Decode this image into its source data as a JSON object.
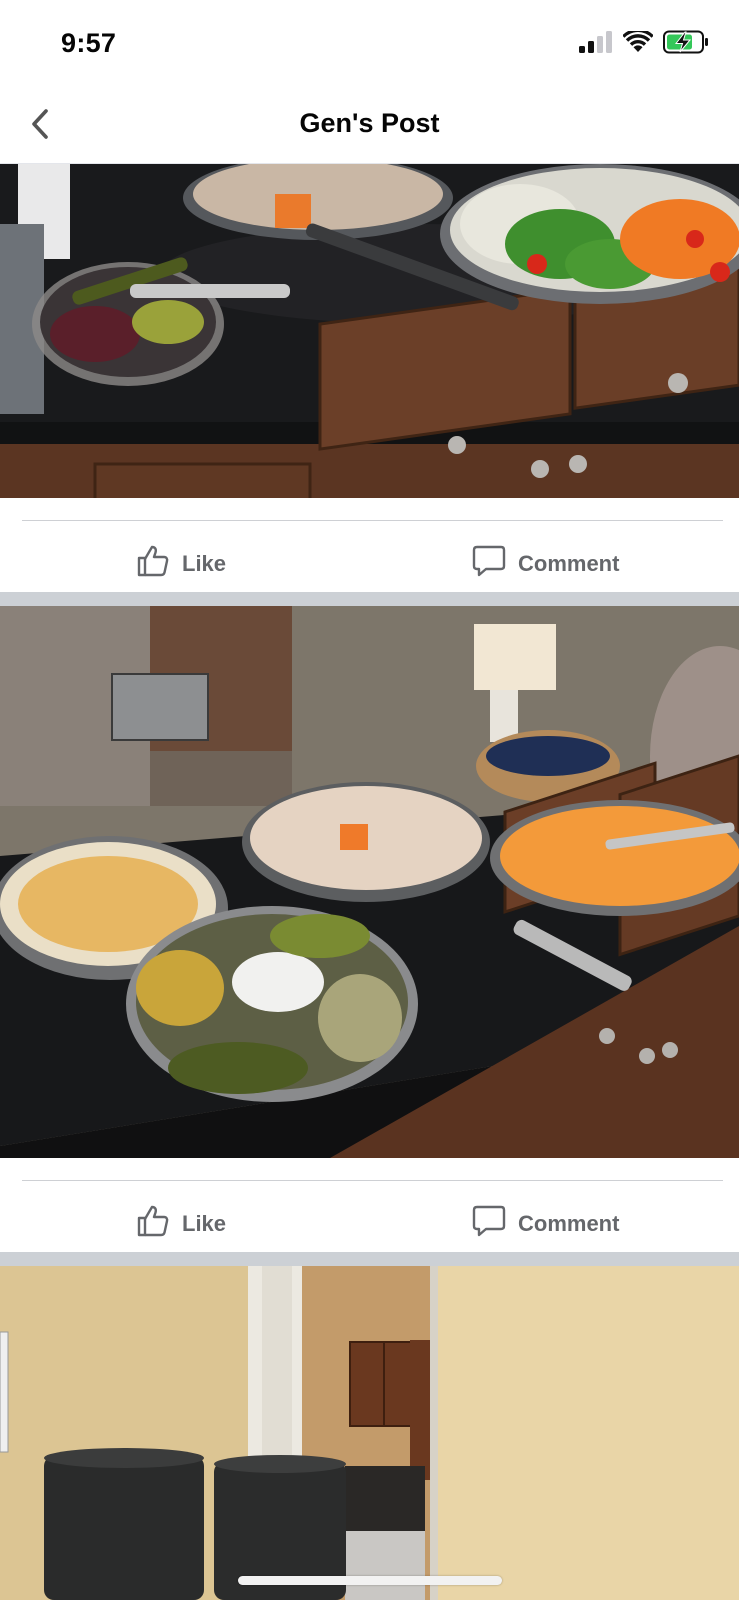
{
  "status_bar": {
    "time": "9:57",
    "signal_icon": "cellular-signal-icon",
    "wifi_icon": "wifi-icon",
    "battery_icon": "battery-charging-icon"
  },
  "header": {
    "title": "Gen's Post",
    "back_icon": "chevron-left-icon"
  },
  "posts": [
    {
      "photo_alt": "",
      "actions": {
        "like_label": "Like",
        "comment_label": "Comment"
      }
    },
    {
      "photo_alt": "",
      "actions": {
        "like_label": "Like",
        "comment_label": "Comment"
      }
    },
    {
      "photo_alt": ""
    }
  ],
  "colors": {
    "action_text": "#65676b",
    "separator": "#ccd0d5",
    "countertop": "#1c1c1e",
    "cabinet": "#5e3622",
    "wall": "#7f776a"
  }
}
